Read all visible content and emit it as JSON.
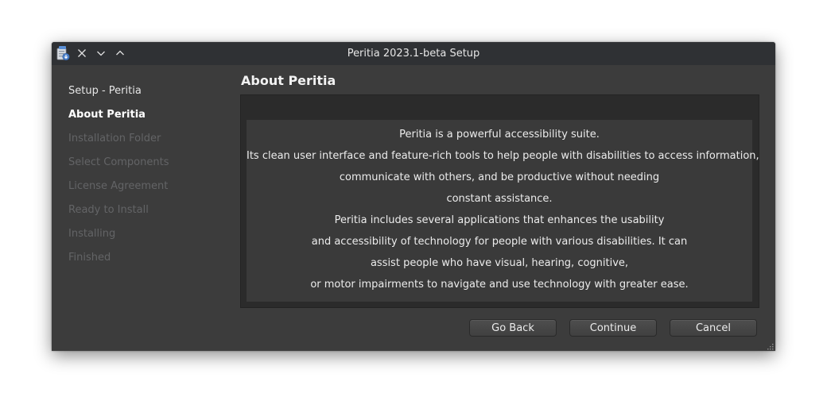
{
  "window": {
    "title": "Peritia 2023.1-beta Setup"
  },
  "titlebar_icons": [
    "installer-app-icon",
    "close-icon",
    "minimize-chevron-down-icon",
    "maximize-chevron-up-icon"
  ],
  "sidebar": {
    "items": [
      {
        "label": "Setup - Peritia",
        "state": "done"
      },
      {
        "label": "About Peritia",
        "state": "current"
      },
      {
        "label": "Installation Folder",
        "state": "pending"
      },
      {
        "label": "Select Components",
        "state": "pending"
      },
      {
        "label": "License Agreement",
        "state": "pending"
      },
      {
        "label": "Ready to Install",
        "state": "pending"
      },
      {
        "label": "Installing",
        "state": "pending"
      },
      {
        "label": "Finished",
        "state": "pending"
      }
    ]
  },
  "main": {
    "title": "About Peritia",
    "description_lines": [
      "Peritia is a powerful accessibility suite.",
      "Its clean user interface and feature-rich tools to help people with disabilities to access information,",
      "communicate with others, and be productive without needing",
      "constant assistance.",
      "Peritia includes several applications that enhances the usability",
      "and accessibility of technology for people with various disabilities. It can",
      "assist people who have visual, hearing, cognitive,",
      "or motor impairments to navigate and use technology with greater ease."
    ]
  },
  "buttons": {
    "back": "Go Back",
    "continue": "Continue",
    "cancel": "Cancel"
  },
  "colors": {
    "window_bg": "#3c3c3c",
    "titlebar_bg": "#2f3134",
    "text_active": "#ffffff",
    "text_pending": "#636466"
  }
}
